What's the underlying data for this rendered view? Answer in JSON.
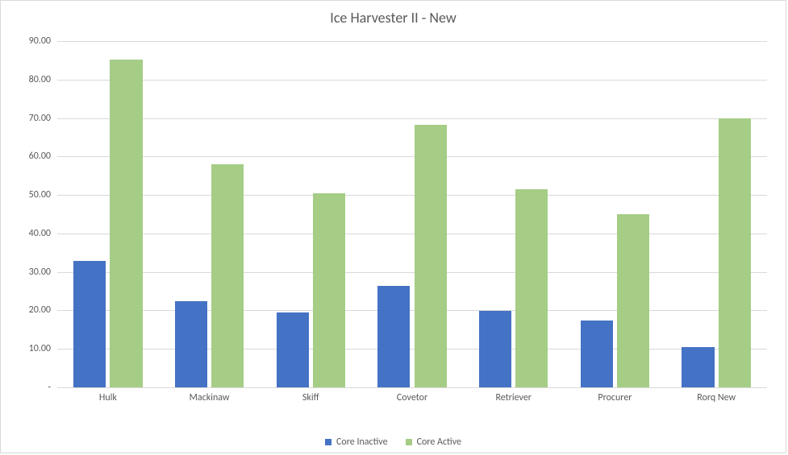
{
  "chart_data": {
    "type": "bar",
    "title": "Ice Harvester II - New",
    "xlabel": "",
    "ylabel": "",
    "ylim": [
      0,
      90
    ],
    "y_ticks": [
      "-",
      "10.00",
      "20.00",
      "30.00",
      "40.00",
      "50.00",
      "60.00",
      "70.00",
      "80.00",
      "90.00"
    ],
    "categories": [
      "Hulk",
      "Mackinaw",
      "Skiff",
      "Covetor",
      "Retriever",
      "Procurer",
      "Rorq New"
    ],
    "series": [
      {
        "name": "Core Inactive",
        "color": "#4472c4",
        "values": [
          32.8,
          22.5,
          19.5,
          26.3,
          19.8,
          17.3,
          10.5
        ]
      },
      {
        "name": "Core Active",
        "color": "#a5cd85",
        "values": [
          85.2,
          58.0,
          50.5,
          68.2,
          51.5,
          45.0,
          70.0
        ]
      }
    ]
  },
  "legend": {
    "inactive": "Core Inactive",
    "active": "Core Active"
  }
}
